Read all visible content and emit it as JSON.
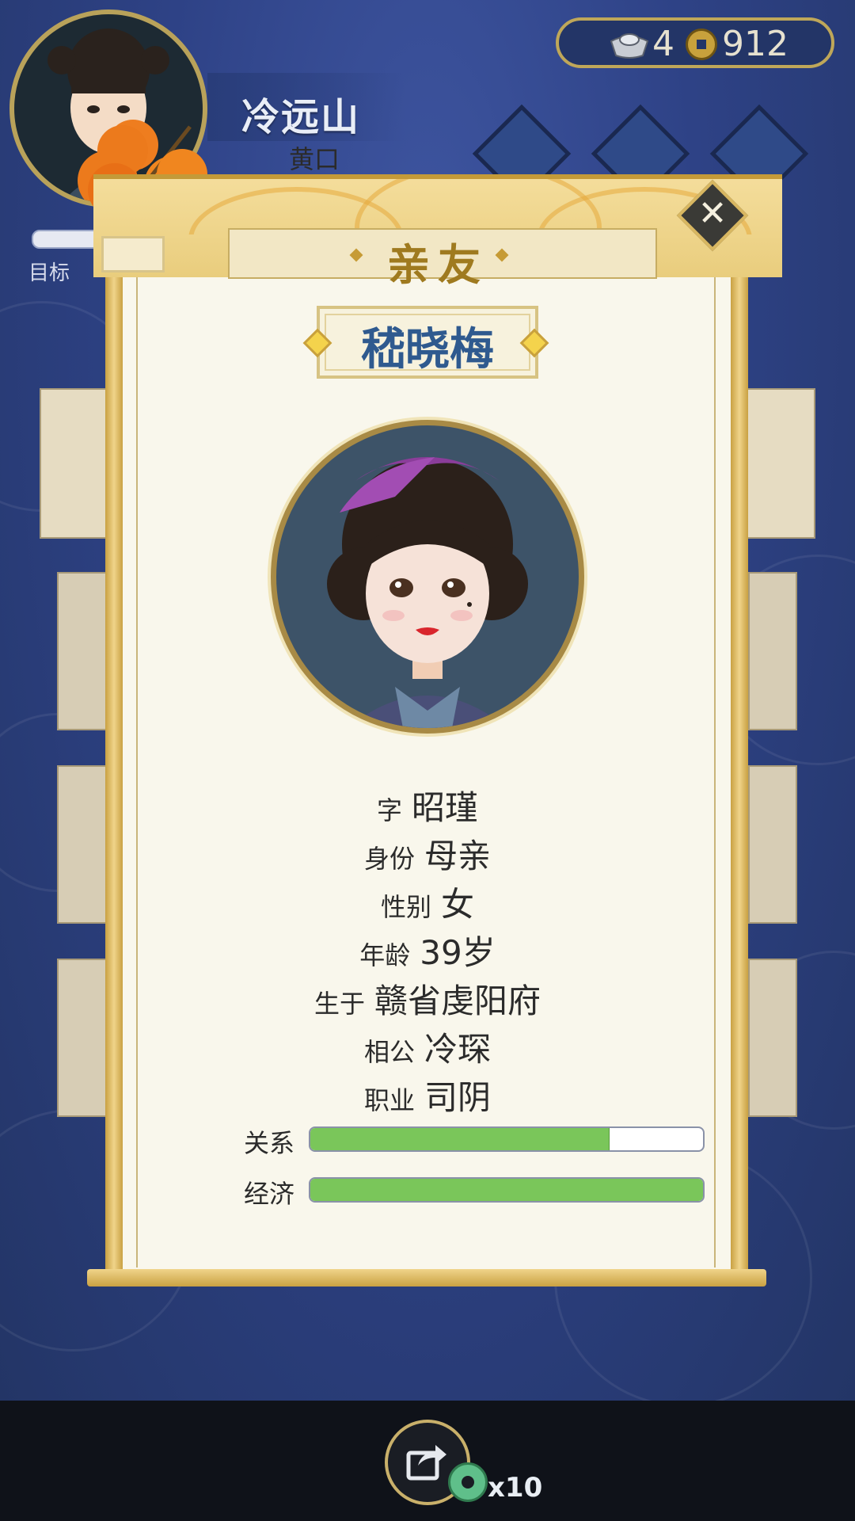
{
  "player": {
    "name": "冷远山",
    "title": "黄口",
    "goal_label": "目标"
  },
  "currency": {
    "ingot_count": "4",
    "coin_count": "912"
  },
  "dialog": {
    "title": "亲友"
  },
  "character": {
    "name": "嵇晓梅",
    "fields": [
      {
        "key": "字",
        "value": "昭瑾"
      },
      {
        "key": "身份",
        "value": "母亲"
      },
      {
        "key": "性别",
        "value": "女"
      },
      {
        "key": "年龄",
        "value": "39岁"
      },
      {
        "key": "生于",
        "value": "赣省虔阳府"
      },
      {
        "key": "相公",
        "value": "冷琛"
      },
      {
        "key": "职业",
        "value": "司阴"
      }
    ],
    "bars": [
      {
        "label": "关系",
        "fraction": 0.76
      },
      {
        "label": "经济",
        "fraction": 1.0
      }
    ]
  },
  "share": {
    "count": "x10"
  },
  "icons": {
    "close": "close-icon",
    "share": "share-icon",
    "ingot": "silver-ingot-icon",
    "coin": "copper-coin-icon",
    "jade": "jade-token-icon"
  },
  "colors": {
    "name_blue": "#2f5a8f",
    "bar_green": "#7ac65a",
    "gold": "#c9a142"
  }
}
